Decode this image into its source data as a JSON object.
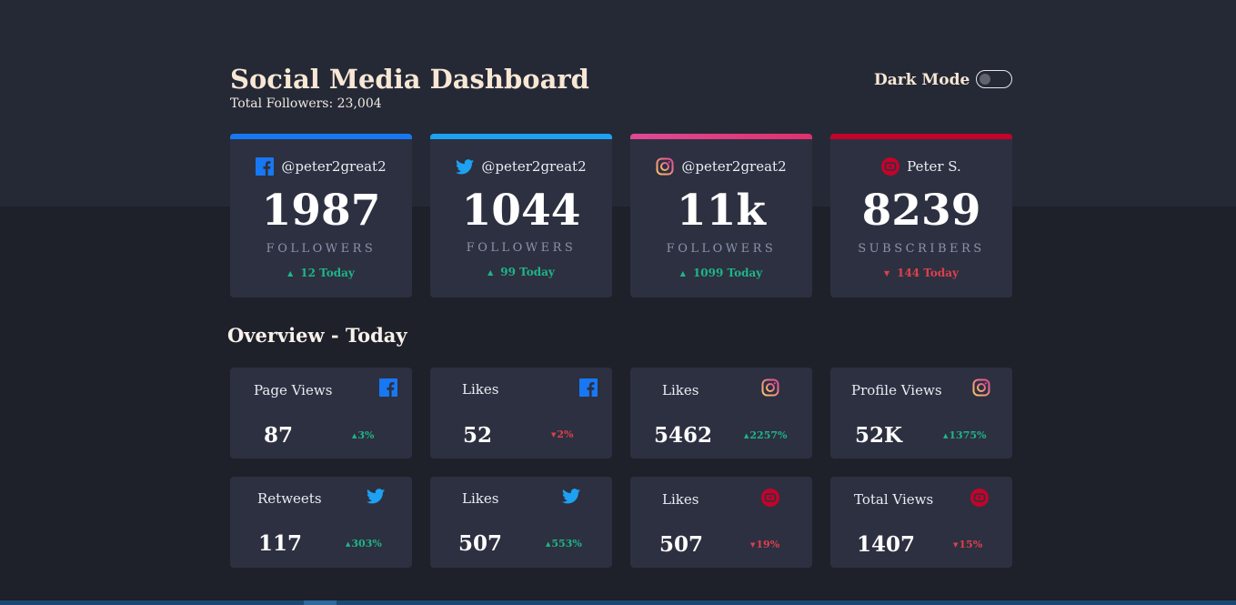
{
  "header": {
    "title": "Social Media Dashboard",
    "total_followers": "Total Followers: 23,004",
    "dark_mode_label": "Dark Mode",
    "dark_mode_on": false
  },
  "colors": {
    "facebook": "#1877f2",
    "twitter": "#1da1f2",
    "instagram": "#e1306c",
    "youtube": "#c4032b",
    "up": "#1eb589",
    "down": "#dc414c"
  },
  "follower_cards": [
    {
      "platform": "facebook",
      "icon": "facebook-icon",
      "handle": "@peter2great2",
      "count": "1987",
      "label": "FOLLOWERS",
      "change": "12 Today",
      "direction": "up"
    },
    {
      "platform": "twitter",
      "icon": "twitter-icon",
      "handle": "@peter2great2",
      "count": "1044",
      "label": "FOLLOWERS",
      "change": "99 Today",
      "direction": "up"
    },
    {
      "platform": "instagram",
      "icon": "instagram-icon",
      "handle": "@peter2great2",
      "count": "11k",
      "label": "FOLLOWERS",
      "change": "1099 Today",
      "direction": "up"
    },
    {
      "platform": "youtube",
      "icon": "youtube-icon",
      "handle": "Peter S.",
      "count": "8239",
      "label": "SUBSCRIBERS",
      "change": "144 Today",
      "direction": "down"
    }
  ],
  "overview": {
    "title": "Overview - Today",
    "cards": [
      {
        "label": "Page Views",
        "icon": "facebook-icon",
        "value": "87",
        "pct": "3%",
        "direction": "up"
      },
      {
        "label": "Likes",
        "icon": "facebook-icon",
        "value": "52",
        "pct": "2%",
        "direction": "down"
      },
      {
        "label": "Likes",
        "icon": "instagram-icon",
        "value": "5462",
        "pct": "2257%",
        "direction": "up"
      },
      {
        "label": "Profile Views",
        "icon": "instagram-icon",
        "value": "52K",
        "pct": "1375%",
        "direction": "up"
      },
      {
        "label": "Retweets",
        "icon": "twitter-icon",
        "value": "117",
        "pct": "303%",
        "direction": "up"
      },
      {
        "label": "Likes",
        "icon": "twitter-icon",
        "value": "507",
        "pct": "553%",
        "direction": "up"
      },
      {
        "label": "Likes",
        "icon": "youtube-icon",
        "value": "507",
        "pct": "19%",
        "direction": "down"
      },
      {
        "label": "Total Views",
        "icon": "youtube-icon",
        "value": "1407",
        "pct": "15%",
        "direction": "down"
      }
    ]
  }
}
